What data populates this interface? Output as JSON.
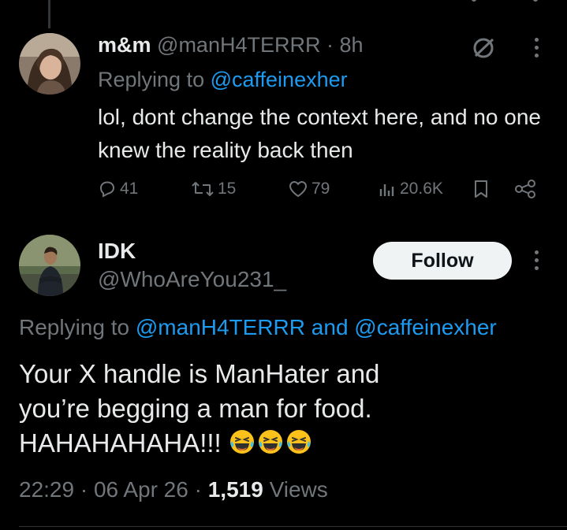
{
  "reply": {
    "name": "m&m",
    "handle": "@manH4TERRR",
    "time": "· 8h",
    "replying_prefix": "Replying to ",
    "replying_to": "@caffeinexher",
    "text": "lol, dont change the context here, and no one knew the reality back then",
    "comments": "41",
    "reposts": "15",
    "likes": "79",
    "views": "20.6K"
  },
  "main": {
    "name": "IDK",
    "handle": "@WhoAreYou231_",
    "follow_label": "Follow",
    "replying_prefix": "Replying to ",
    "replying_to_1": "@manH4TERRR",
    "replying_and": " and ",
    "replying_to_2": "@caffeinexher",
    "text_line1": "Your X handle is ManHater and",
    "text_line2": "you’re begging a man for food.",
    "text_line3": "HAHAHAHAHA!!! ",
    "time": "22:29 · 06 Apr 26 · ",
    "views_count": "1,519",
    "views_label": " Views"
  },
  "colors": {
    "background": "#000000",
    "link": "#1d9bf0",
    "muted": "#71767b",
    "text": "#e7e9ea"
  }
}
